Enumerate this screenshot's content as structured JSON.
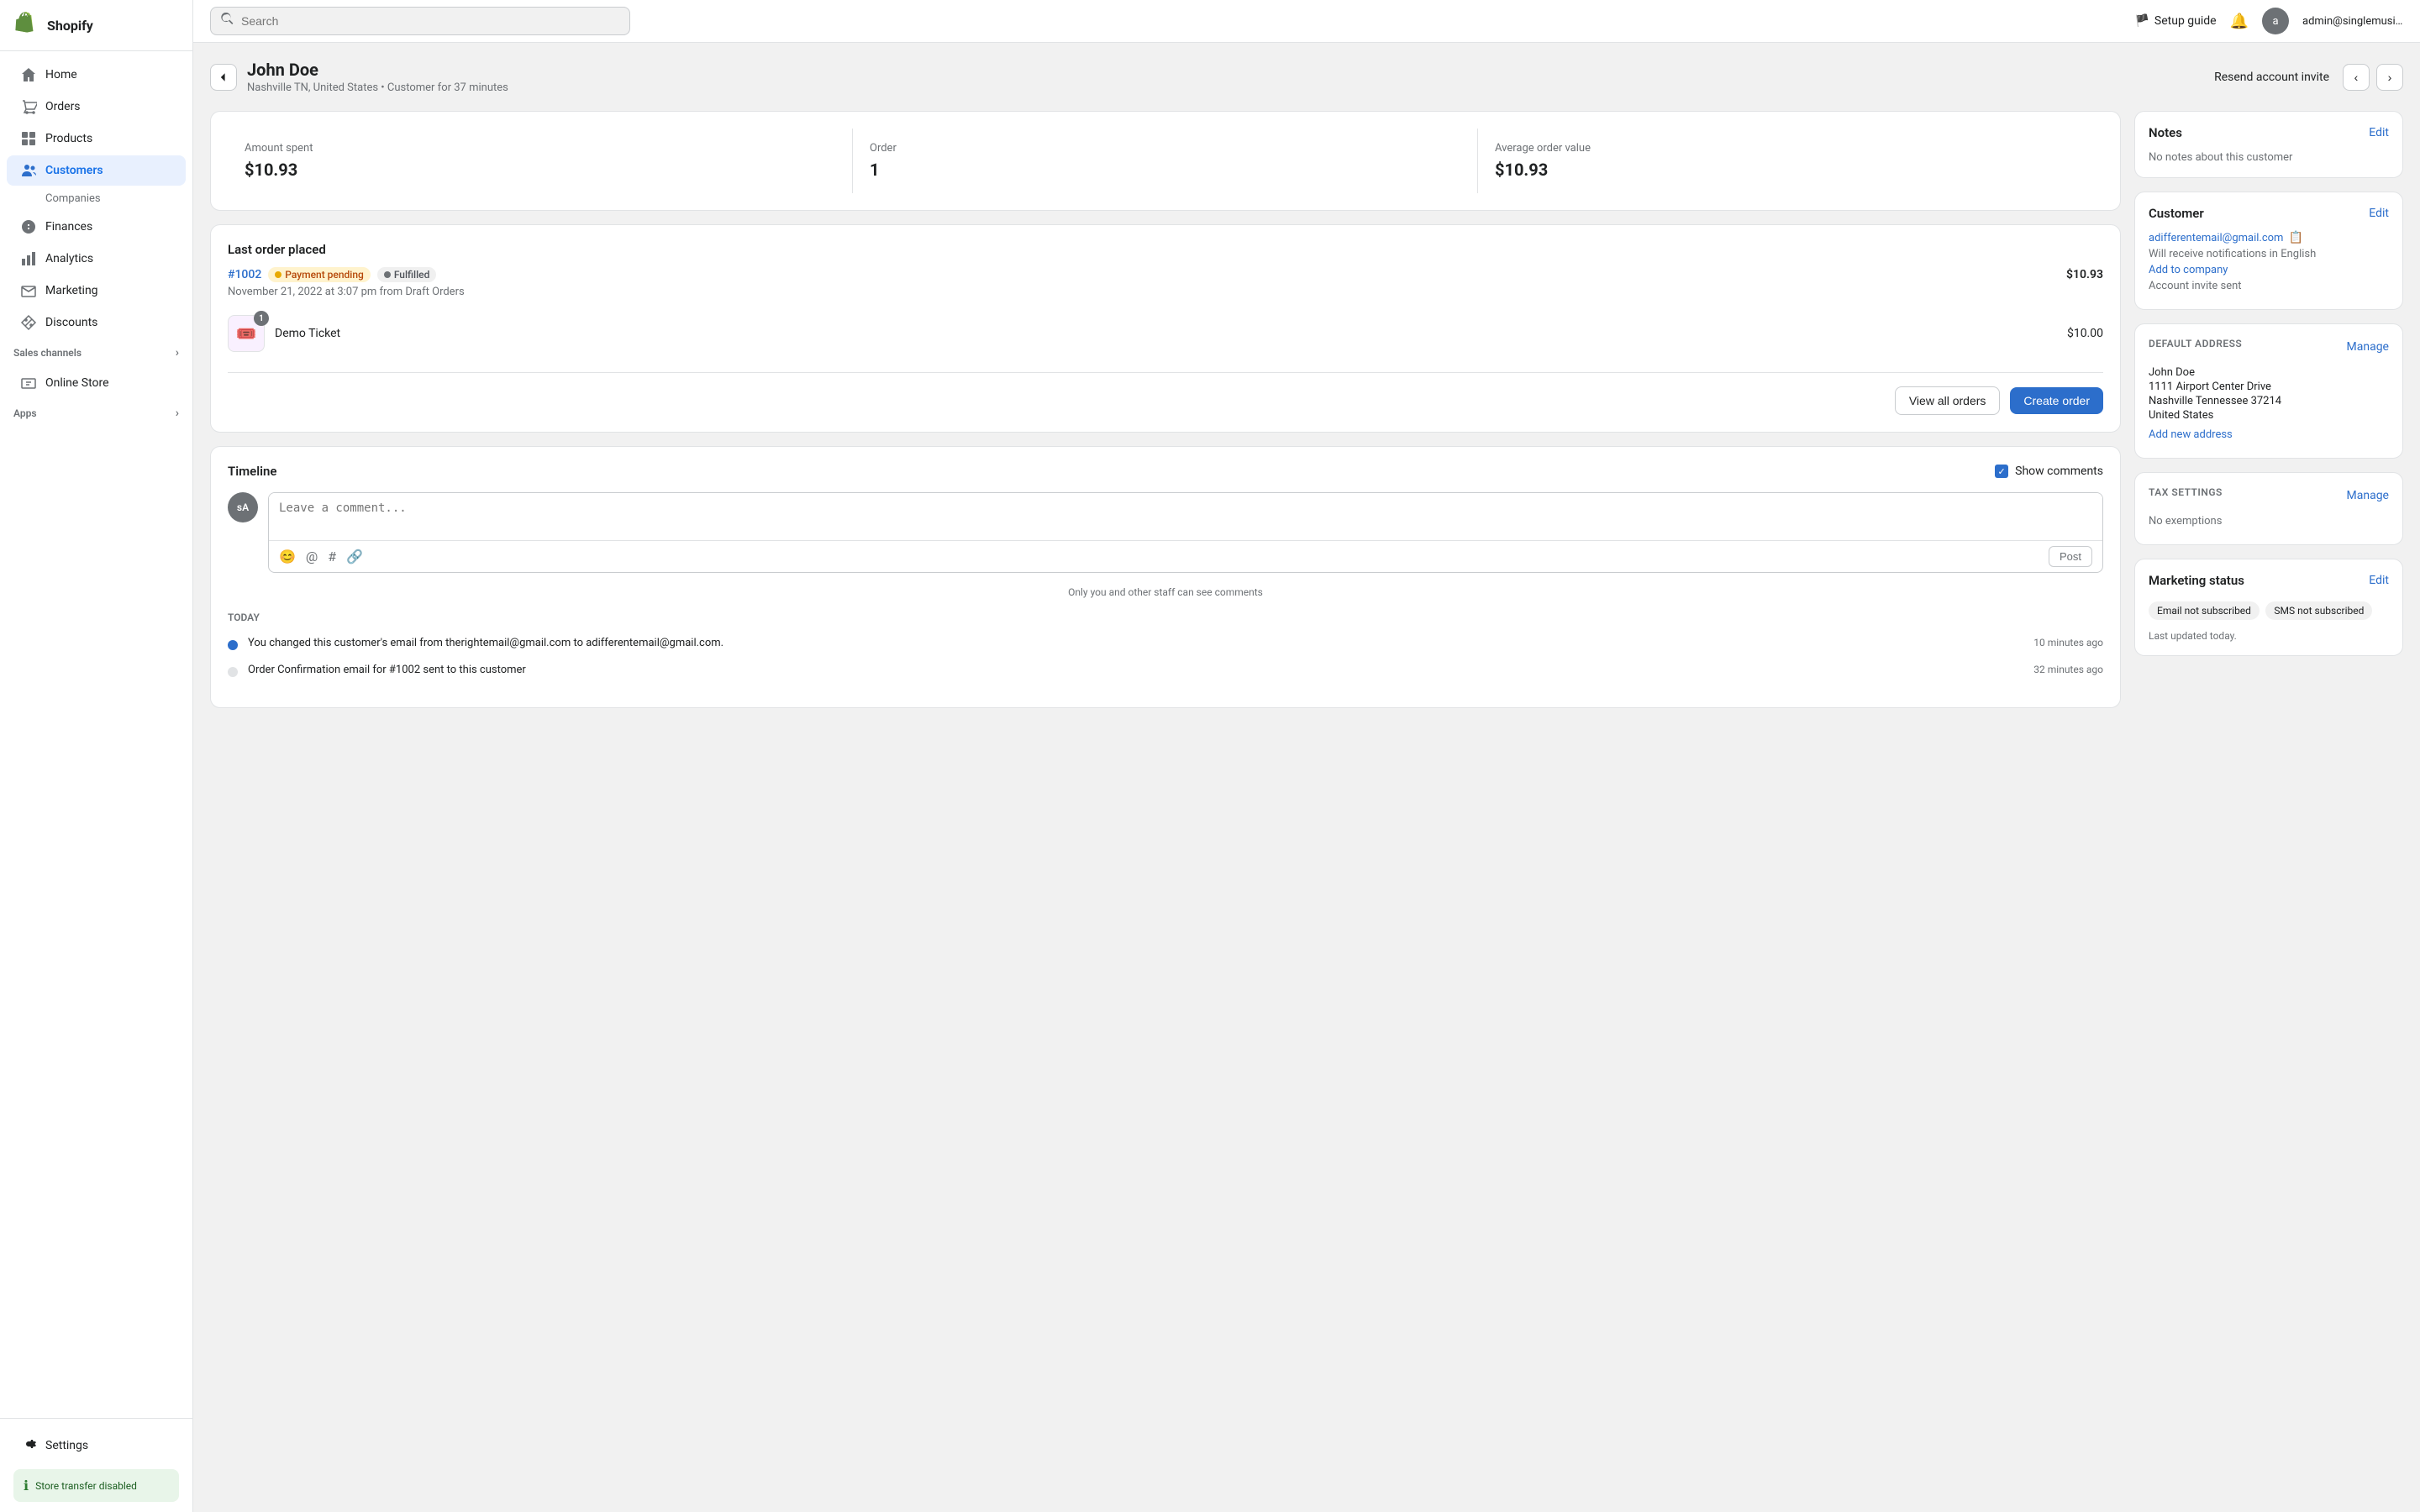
{
  "app": {
    "name": "Shopify"
  },
  "topbar": {
    "search_placeholder": "Search",
    "setup_guide": "Setup guide",
    "admin_email": "admin@singlemusic.c...",
    "avatar_initials": "a"
  },
  "sidebar": {
    "nav_items": [
      {
        "id": "home",
        "label": "Home",
        "icon": "home"
      },
      {
        "id": "orders",
        "label": "Orders",
        "icon": "orders"
      },
      {
        "id": "products",
        "label": "Products",
        "icon": "products"
      },
      {
        "id": "customers",
        "label": "Customers",
        "icon": "customers",
        "active": true
      },
      {
        "id": "companies",
        "label": "Companies",
        "sub": true
      },
      {
        "id": "finances",
        "label": "Finances",
        "icon": "finances"
      },
      {
        "id": "analytics",
        "label": "Analytics",
        "icon": "analytics"
      },
      {
        "id": "marketing",
        "label": "Marketing",
        "icon": "marketing"
      },
      {
        "id": "discounts",
        "label": "Discounts",
        "icon": "discounts"
      }
    ],
    "sales_channels_label": "Sales channels",
    "online_store": "Online Store",
    "apps_label": "Apps",
    "settings_label": "Settings",
    "store_transfer": "Store transfer disabled"
  },
  "page": {
    "back_label": "←",
    "title": "John Doe",
    "subtitle": "Nashville TN, United States • Customer for 37 minutes",
    "resend_label": "Resend account invite",
    "prev_label": "‹",
    "next_label": "›"
  },
  "stats": {
    "amount_spent_label": "Amount spent",
    "amount_spent_value": "$10.93",
    "order_label": "Order",
    "order_value": "1",
    "avg_order_label": "Average order value",
    "avg_order_value": "$10.93"
  },
  "last_order": {
    "title": "Last order placed",
    "order_id": "#1002",
    "badge_payment": "Payment pending",
    "badge_fulfilled": "Fulfilled",
    "amount": "$10.93",
    "date": "November 21, 2022 at 3:07 pm from Draft Orders",
    "product_name": "Demo Ticket",
    "product_price": "$10.00",
    "product_qty": "1",
    "view_all_label": "View all orders",
    "create_order_label": "Create order"
  },
  "timeline": {
    "title": "Timeline",
    "show_comments_label": "Show comments",
    "comment_placeholder": "Leave a comment...",
    "post_label": "Post",
    "hint": "Only you and other staff can see comments",
    "today_label": "TODAY",
    "entries": [
      {
        "text": "You changed this customer's email from therightemail@gmail.com to adifferentemail@gmail.com.",
        "time": "10 minutes ago"
      },
      {
        "text": "Order Confirmation email for #1002 sent to this customer",
        "time": "32 minutes ago"
      }
    ]
  },
  "notes_card": {
    "title": "Notes",
    "edit_label": "Edit",
    "empty_text": "No notes about this customer"
  },
  "customer_card": {
    "title": "Customer",
    "edit_label": "Edit",
    "email": "adifferentemail@gmail.com",
    "notification_lang": "Will receive notifications in English",
    "add_company": "Add to company",
    "account_invite": "Account invite sent"
  },
  "address_card": {
    "title": "DEFAULT ADDRESS",
    "manage_label": "Manage",
    "name": "John Doe",
    "street": "1111 Airport Center Drive",
    "city_state": "Nashville Tennessee 37214",
    "country": "United States",
    "add_new": "Add new address"
  },
  "tax_card": {
    "title": "TAX SETTINGS",
    "manage_label": "Manage",
    "exemptions": "No exemptions"
  },
  "marketing_card": {
    "title": "Marketing status",
    "edit_label": "Edit",
    "email_badge": "Email not subscribed",
    "sms_badge": "SMS not subscribed",
    "last_updated": "Last updated today."
  }
}
